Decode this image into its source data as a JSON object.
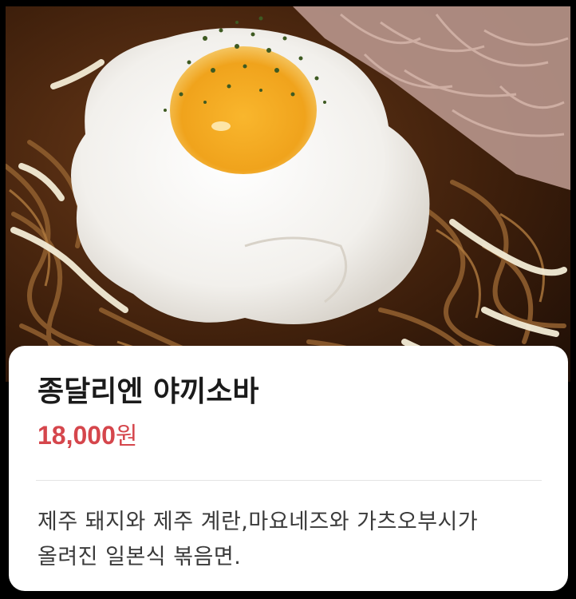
{
  "menu_item": {
    "title": "종달리엔 야끼소바",
    "price_amount": "18,000",
    "price_unit": "원",
    "description": "제주 돼지와 제주 계란,마요네즈와 가츠오부시가 올려진 일본식 볶음면."
  },
  "colors": {
    "price": "#d5464c",
    "card_background": "#ffffff",
    "frame": "#000000"
  }
}
